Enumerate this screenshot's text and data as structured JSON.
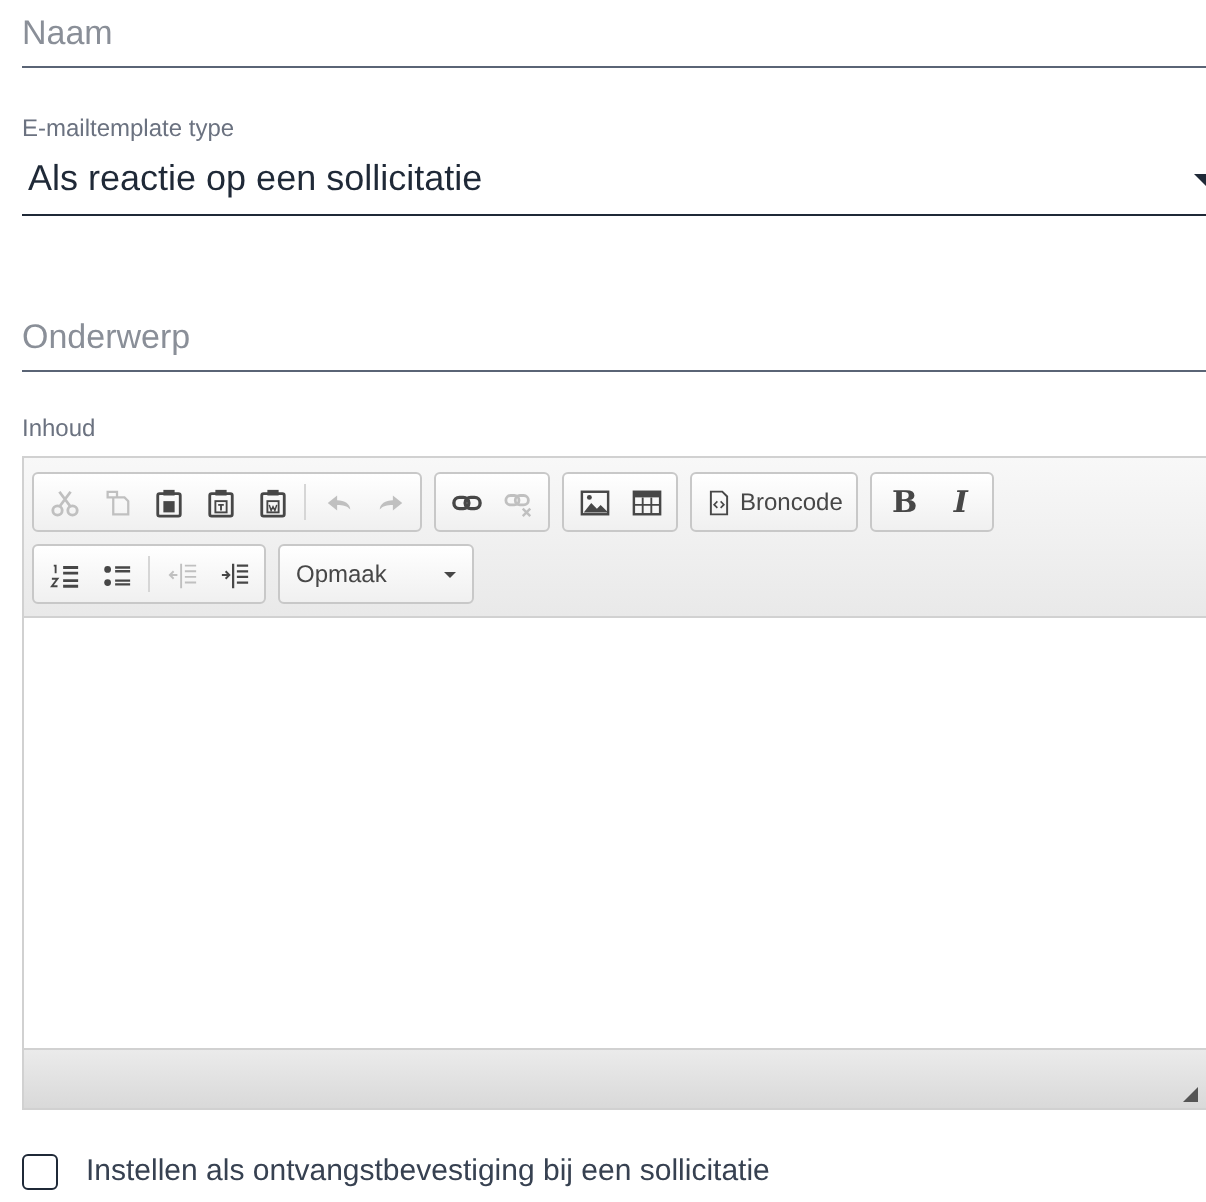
{
  "name_field": {
    "placeholder": "Naam"
  },
  "template_type": {
    "label": "E-mailtemplate type",
    "value": "Als reactie op een sollicitatie"
  },
  "subject_field": {
    "placeholder": "Onderwerp"
  },
  "content": {
    "label": "Inhoud",
    "toolbar_rows": [
      [
        [
          {
            "kind": "icon",
            "disabled": true
          },
          {
            "kind": "icon",
            "disabled": true
          },
          {
            "kind": "icon",
            "disabled": false
          },
          {
            "kind": "icon",
            "disabled": false
          },
          {
            "kind": "icon",
            "disabled": false
          },
          {
            "kind": "separator"
          },
          {
            "kind": "icon",
            "disabled": true
          },
          {
            "kind": "icon",
            "disabled": true
          }
        ],
        [
          {
            "kind": "icon",
            "disabled": false
          },
          {
            "kind": "icon",
            "disabled": true
          }
        ],
        [
          {
            "kind": "icon",
            "disabled": false
          },
          {
            "kind": "icon",
            "disabled": false
          }
        ],
        [
          {
            "kind": "icon_text",
            "label": "Broncode",
            "disabled": false
          }
        ],
        [
          {
            "kind": "glyph",
            "label": "B",
            "disabled": false
          },
          {
            "kind": "glyph",
            "label": "I",
            "disabled": false
          }
        ]
      ],
      [
        [
          {
            "kind": "icon",
            "disabled": false
          },
          {
            "kind": "icon",
            "disabled": false
          },
          {
            "kind": "separator"
          },
          {
            "kind": "icon",
            "disabled": true
          },
          {
            "kind": "icon",
            "disabled": false
          }
        ],
        [
          {
            "kind": "dropdown",
            "label": "Opmaak",
            "disabled": false
          }
        ]
      ]
    ]
  },
  "confirmation_checkbox": {
    "label": "Instellen als ontvangstbevestiging bij een sollicitatie",
    "checked": false
  }
}
